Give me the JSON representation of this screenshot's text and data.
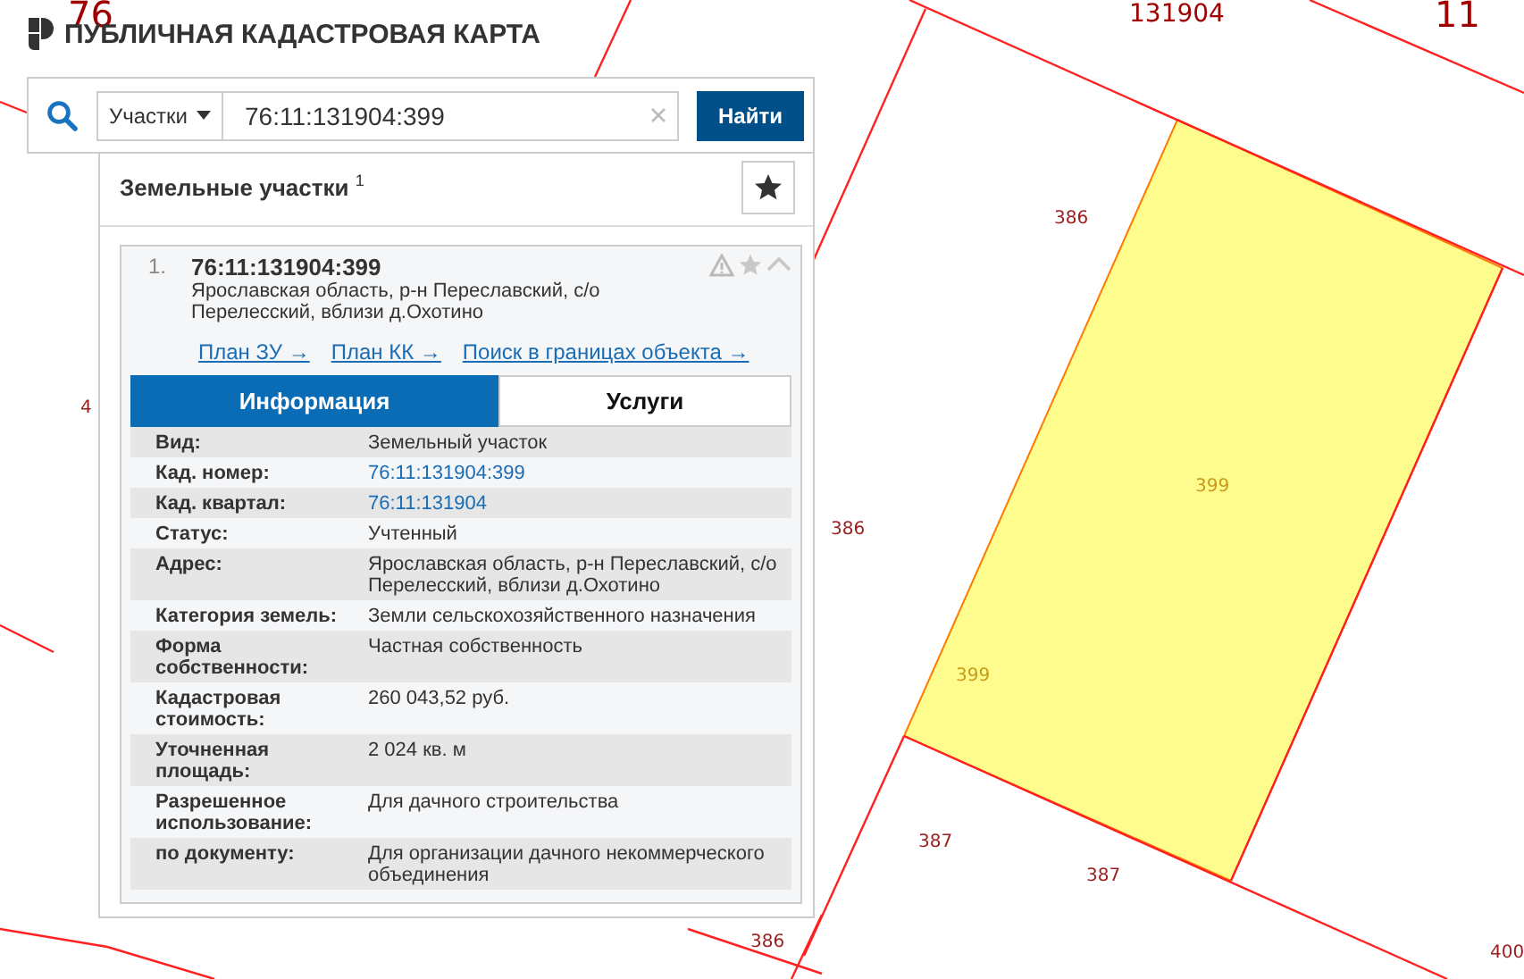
{
  "header": {
    "title": "ПУБЛИЧНАЯ КАДАСТРОВАЯ КАРТА"
  },
  "search": {
    "type_select": "Участки",
    "value": "76:11:131904:399",
    "button": "Найти"
  },
  "results": {
    "title": "Земельные участки $^{1}$",
    "items": [
      {
        "number": "1.",
        "cadastral": "76:11:131904:399",
        "address": "Ярославская область, р-н Переславский, с/о Перелесский, вблизи д.Охотино",
        "links": [
          "План ЗУ →",
          "План КК →",
          "Поиск в границах объекта →"
        ],
        "tabs": [
          {
            "label": "Информация",
            "selected": true
          },
          {
            "label": "Услуги",
            "selected": false
          }
        ],
        "fields": [
          {
            "label": "Вид:",
            "value": "Земельный участок",
            "kind": "text"
          },
          {
            "label": "Кад. номер:",
            "value": "76:11:131904:399",
            "kind": "link"
          },
          {
            "label": "Кад. квартал:",
            "value": "76:11:131904",
            "kind": "link"
          },
          {
            "label": "Статус:",
            "value": "Учтенный",
            "kind": "text"
          },
          {
            "label": "Адрес:",
            "value": "Ярославская область, р-н Переславский, с/о Перелесский, вблизи д.Охотино",
            "kind": "text"
          },
          {
            "label": "Категория земель:",
            "value": "Земли сельскохозяйственного назначения",
            "kind": "text"
          },
          {
            "label": "Форма собственности:",
            "value": "Частная собственность",
            "kind": "text"
          },
          {
            "label": "Кадастровая стоимость:",
            "value": "260 043,52 руб.",
            "kind": "text"
          },
          {
            "label": "Уточненная площадь:",
            "value": "2 024 кв. м",
            "kind": "text"
          },
          {
            "label": "Разрешенное использование:",
            "value": "Для дачного строительства",
            "kind": "text"
          },
          {
            "label": "по документу:",
            "value": "Для организации дачного некоммерческого объединения",
            "kind": "text"
          }
        ]
      }
    ]
  },
  "map_labels": [
    {
      "text": "76",
      "kind": "quarter"
    },
    {
      "text": "131904",
      "kind": "block"
    },
    {
      "text": "11",
      "kind": "quarter"
    },
    {
      "text": "4",
      "kind": "parcel"
    },
    {
      "text": "386",
      "kind": "parcel"
    },
    {
      "text": "399",
      "kind": "selected"
    },
    {
      "text": "386",
      "kind": "parcel"
    },
    {
      "text": "399",
      "kind": "selected"
    },
    {
      "text": "387",
      "kind": "parcel"
    },
    {
      "text": "387",
      "kind": "parcel"
    },
    {
      "text": "386",
      "kind": "parcel"
    },
    {
      "text": "400",
      "kind": "parcel"
    }
  ]
}
